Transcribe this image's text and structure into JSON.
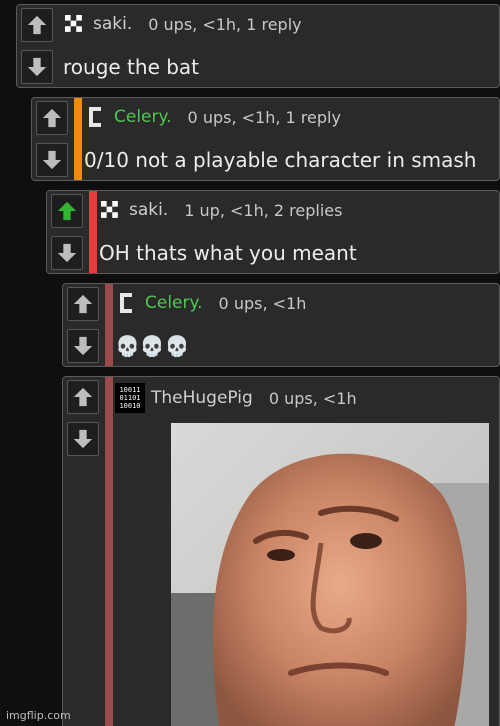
{
  "colors": {
    "bar_orange": "#f08a00",
    "bar_red": "#e53b3b",
    "bar_muted": "#9b4b4b",
    "upvote_active": "#33b533",
    "username_green": "#4ec94e"
  },
  "comments": [
    {
      "username": "saki.",
      "stats": "0 ups, <1h, 1 reply",
      "text": "rouge the bat",
      "avatar_icon": "checker-avatar-icon",
      "username_color": "grey",
      "upvoted": false
    },
    {
      "username": "Celery.",
      "stats": "0 ups, <1h, 1 reply",
      "text": "0/10 not a playable character in smash",
      "avatar_icon": "bracket-avatar-icon",
      "username_color": "green",
      "bar_color": "orange",
      "upvoted": false
    },
    {
      "username": "saki.",
      "stats": "1 up, <1h, 2 replies",
      "text": "OH thats what you meant",
      "avatar_icon": "checker-avatar-icon",
      "username_color": "grey",
      "bar_color": "red",
      "upvoted": true
    },
    {
      "username": "Celery.",
      "stats": "0 ups, <1h",
      "text": "💀💀💀",
      "avatar_icon": "bracket-avatar-icon",
      "username_color": "green",
      "bar_color": "muted",
      "upvoted": false
    },
    {
      "username": "TheHugePig",
      "stats": "0 ups, <1h",
      "avatar_icon": "binary-avatar-icon",
      "avatar_text": [
        "10011",
        "01101",
        "10010"
      ],
      "username_color": "grey",
      "bar_color": "muted",
      "upvoted": false,
      "image": "bald-man-raised-eyebrow-image"
    }
  ],
  "watermark": "imgflip.com"
}
